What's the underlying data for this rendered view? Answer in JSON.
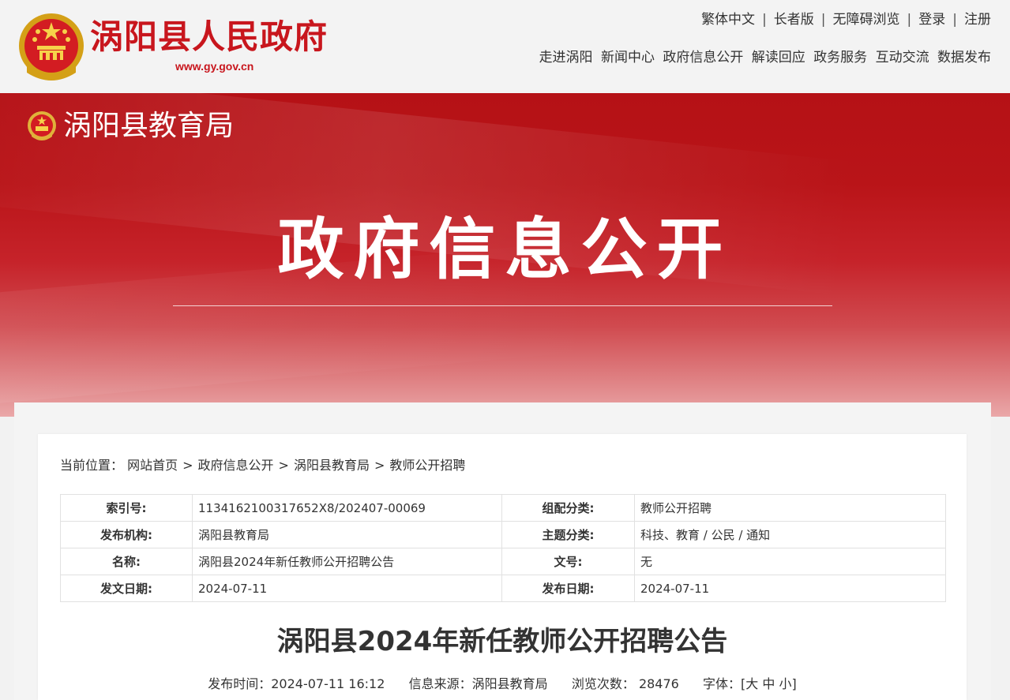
{
  "header": {
    "site_title": "涡阳县人民政府",
    "site_url": "www.gy.gov.cn",
    "util_links": [
      "繁体中文",
      "长者版",
      "无障碍浏览",
      "登录",
      "注册"
    ],
    "nav": [
      "走进涡阳",
      "新闻中心",
      "政府信息公开",
      "解读回应",
      "政务服务",
      "互动交流",
      "数据发布"
    ]
  },
  "banner": {
    "dept_name": "涡阳县教育局",
    "title": "政府信息公开"
  },
  "breadcrumb": {
    "prefix": "当前位置：",
    "items": [
      "网站首页",
      "政府信息公开",
      "涡阳县教育局",
      "教师公开招聘"
    ],
    "separator": ">"
  },
  "meta_table": {
    "rows": [
      {
        "k1": "索引号:",
        "v1": "1134162100317652X8/202407-00069",
        "k2": "组配分类:",
        "v2": "教师公开招聘"
      },
      {
        "k1": "发布机构:",
        "v1": "涡阳县教育局",
        "k2": "主题分类:",
        "v2": "科技、教育 / 公民 / 通知"
      },
      {
        "k1": "名称:",
        "v1": "涡阳县2024年新任教师公开招聘公告",
        "k2": "文号:",
        "v2": "无"
      },
      {
        "k1": "发文日期:",
        "v1": "2024-07-11",
        "k2": "发布日期:",
        "v2": "2024-07-11"
      }
    ]
  },
  "article": {
    "title": "涡阳县2024年新任教师公开招聘公告",
    "publish_label": "发布时间：",
    "publish_time": "2024-07-11 16:12",
    "source_label": "信息来源：",
    "source": "涡阳县教育局",
    "views_label": "浏览次数：",
    "views": "28476",
    "font_label": "字体：",
    "font_open": "[",
    "font_large": "大",
    "font_medium": "中",
    "font_small": "小",
    "font_close": "]"
  },
  "colors": {
    "brand_red": "#c8161d",
    "banner_top": "#b51116",
    "banner_bottom": "#eaa8a9"
  }
}
